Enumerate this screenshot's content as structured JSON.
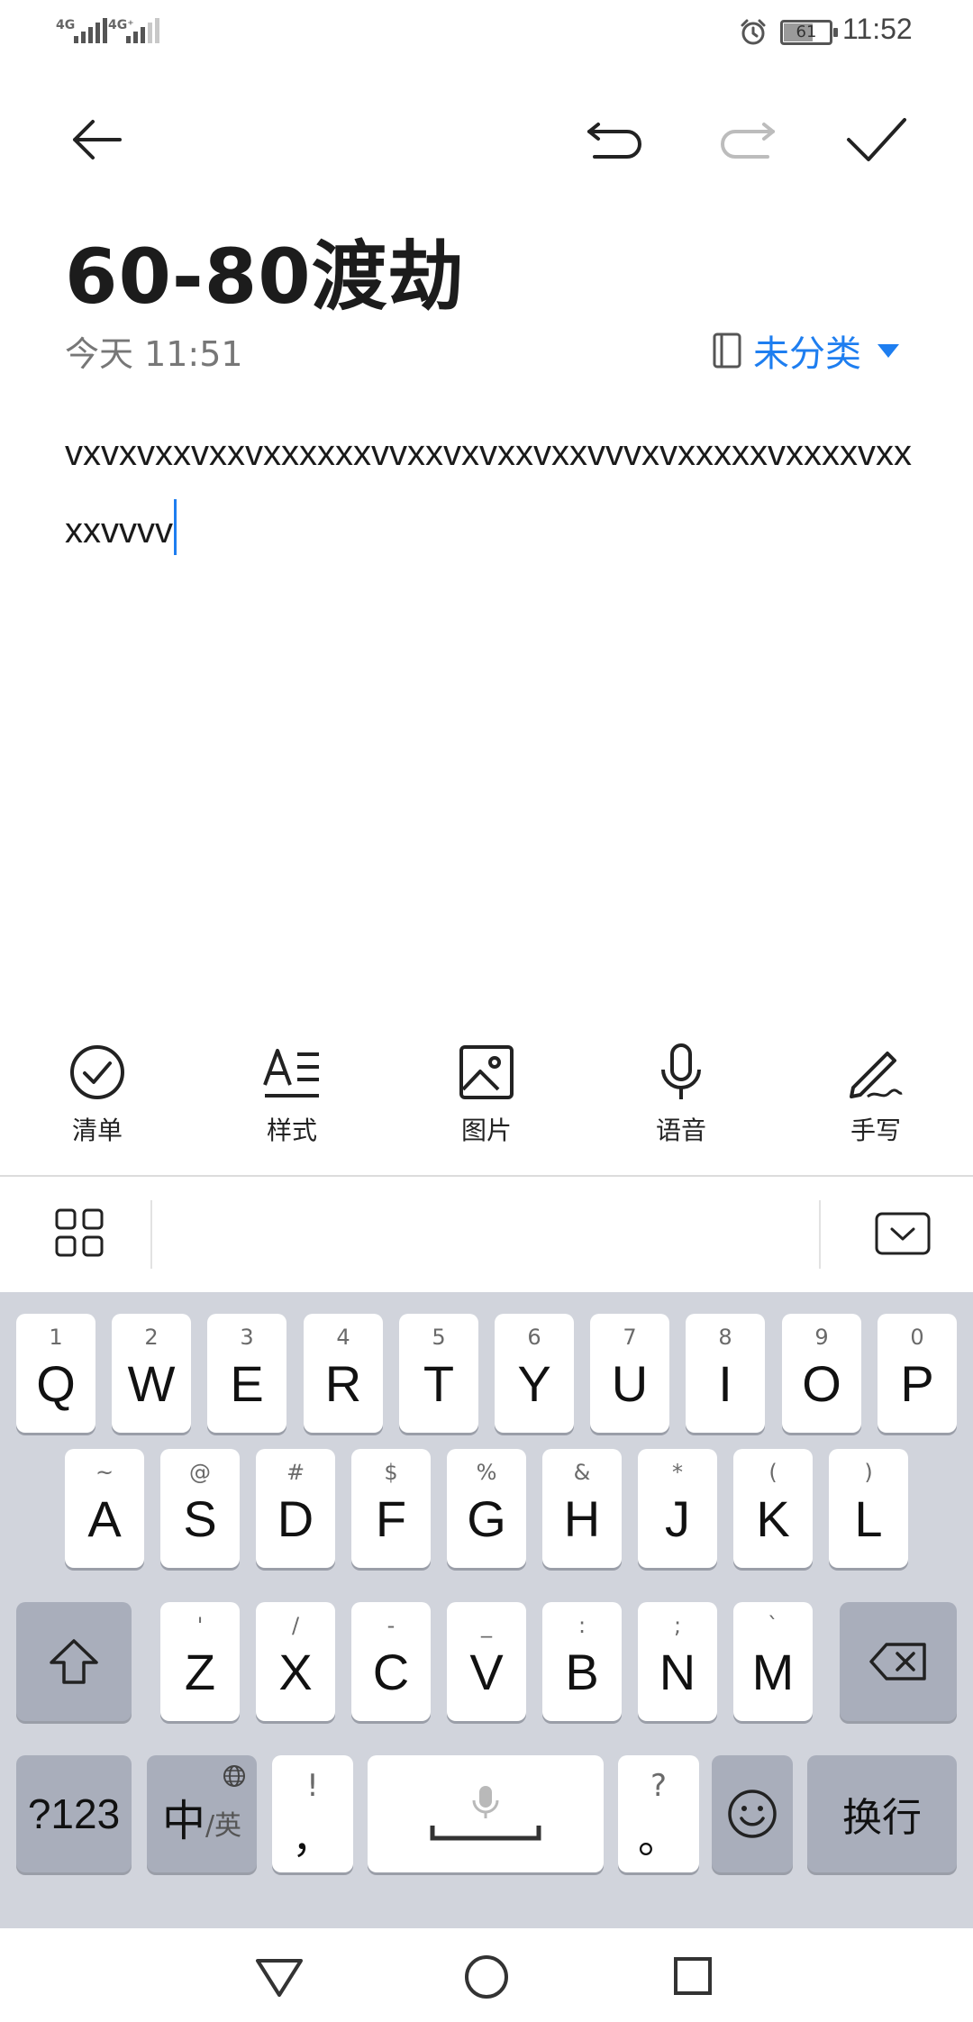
{
  "status": {
    "sim1": "4G",
    "sim2": "4G⁺",
    "battery": "61",
    "time": "11:52"
  },
  "note": {
    "title": "60-80渡劫",
    "date": "今天 11:51",
    "category": "未分类",
    "body": "vxvxvxxvxxvxxxxxxvvxxvxvxxvxxvvvxvxxxxxvxxxxvxxxxvvvv"
  },
  "tools": [
    {
      "label": "清单",
      "icon": "checklist-icon"
    },
    {
      "label": "样式",
      "icon": "text-style-icon"
    },
    {
      "label": "图片",
      "icon": "image-icon"
    },
    {
      "label": "语音",
      "icon": "microphone-icon"
    },
    {
      "label": "手写",
      "icon": "handwriting-pen-icon"
    }
  ],
  "keyboard": {
    "row1": [
      {
        "main": "Q",
        "hint": "1"
      },
      {
        "main": "W",
        "hint": "2"
      },
      {
        "main": "E",
        "hint": "3"
      },
      {
        "main": "R",
        "hint": "4"
      },
      {
        "main": "T",
        "hint": "5"
      },
      {
        "main": "Y",
        "hint": "6"
      },
      {
        "main": "U",
        "hint": "7"
      },
      {
        "main": "I",
        "hint": "8"
      },
      {
        "main": "O",
        "hint": "9"
      },
      {
        "main": "P",
        "hint": "0"
      }
    ],
    "row2": [
      {
        "main": "A",
        "hint": "~"
      },
      {
        "main": "S",
        "hint": "@"
      },
      {
        "main": "D",
        "hint": "#"
      },
      {
        "main": "F",
        "hint": "$"
      },
      {
        "main": "G",
        "hint": "%"
      },
      {
        "main": "H",
        "hint": "&"
      },
      {
        "main": "J",
        "hint": "*"
      },
      {
        "main": "K",
        "hint": "("
      },
      {
        "main": "L",
        "hint": ")"
      }
    ],
    "row3": [
      {
        "main": "Z",
        "hint": "'"
      },
      {
        "main": "X",
        "hint": "/"
      },
      {
        "main": "C",
        "hint": "-"
      },
      {
        "main": "V",
        "hint": "_"
      },
      {
        "main": "B",
        "hint": ":"
      },
      {
        "main": "N",
        "hint": ";"
      },
      {
        "main": "M",
        "hint": "`"
      }
    ],
    "numbers_key": "?123",
    "lang_main": "中",
    "lang_sub": "/英",
    "comma_hint": "!",
    "comma_main": "，",
    "period_hint": "?",
    "period_main": "。",
    "enter_label": "换行"
  }
}
